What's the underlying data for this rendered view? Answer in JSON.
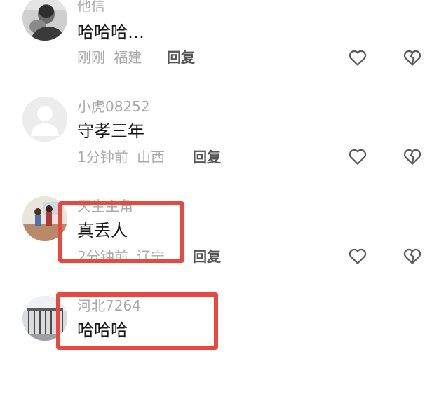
{
  "comments": [
    {
      "username": "他信",
      "content": "哈哈哈…",
      "time": "刚刚",
      "location": "福建",
      "reply_label": "回复",
      "avatar_icon": "man-holding-baby-avatar"
    },
    {
      "username": "小虎08252",
      "content": "守孝三年",
      "time": "1分钟前",
      "location": "山西",
      "reply_label": "回复",
      "avatar_icon": "default-user-avatar"
    },
    {
      "username": "天生主角",
      "content": "真丢人",
      "time": "2分钟前",
      "location": "辽宁",
      "reply_label": "回复",
      "avatar_icon": "cartoon-couple-avatar"
    },
    {
      "username": "河北7264",
      "content": "哈哈哈",
      "time": "",
      "location": "",
      "reply_label": "",
      "avatar_icon": "gate-photo-avatar"
    }
  ],
  "icons": {
    "like": "heart-outline-icon",
    "dislike": "broken-heart-icon"
  },
  "colors": {
    "highlight": "#e8483f",
    "muted_text": "#a9a9a9",
    "content_text": "#161616",
    "reply_text": "#555555"
  }
}
